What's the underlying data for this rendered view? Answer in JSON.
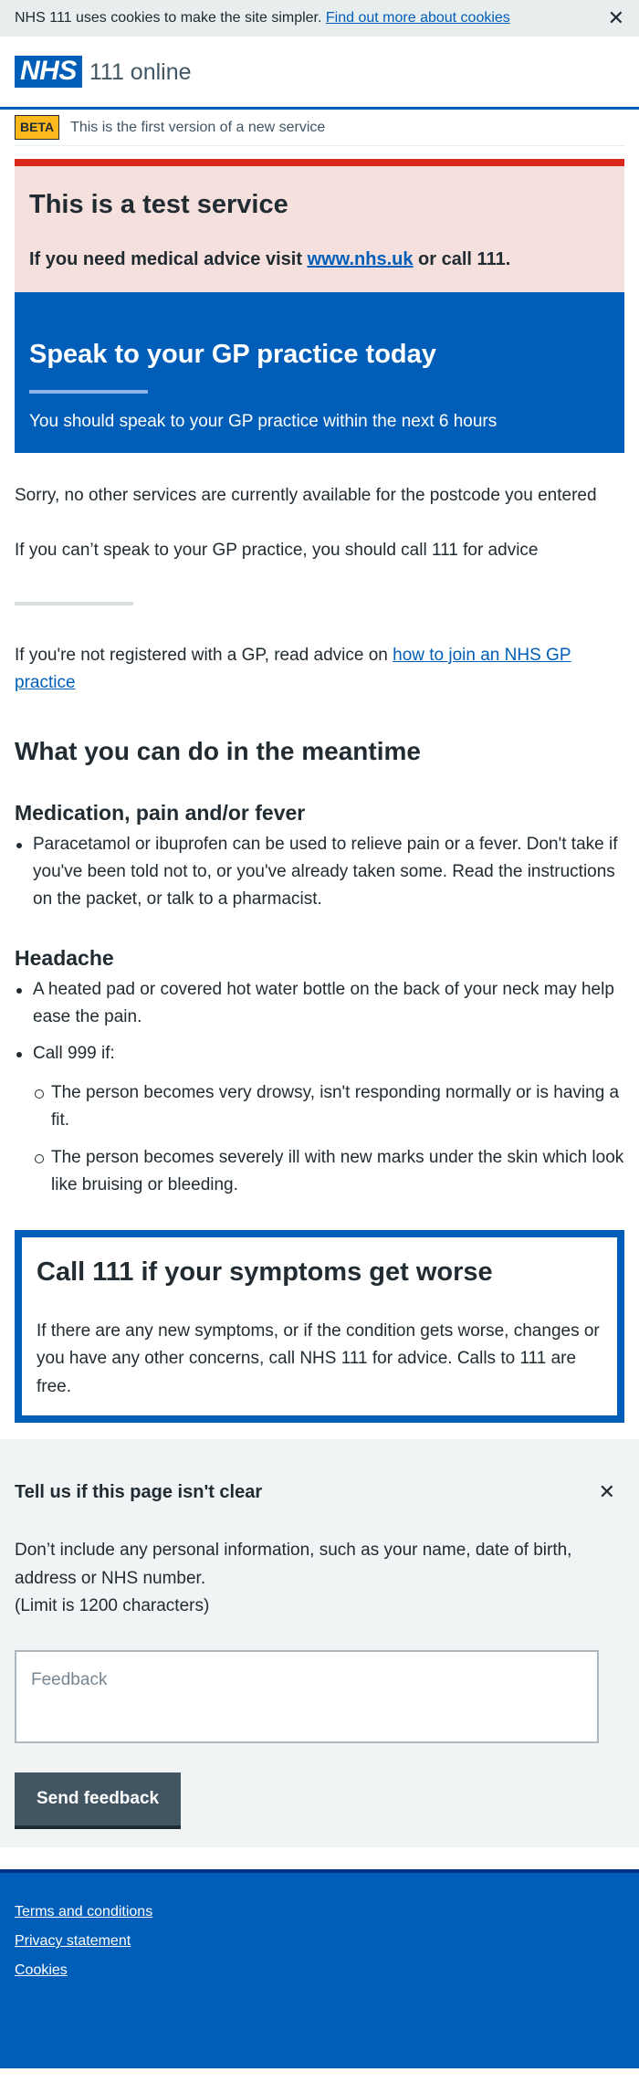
{
  "cookie_banner": {
    "text": "NHS 111 uses cookies to make the site simpler.",
    "link": "Find out more about cookies",
    "close": "✕"
  },
  "header": {
    "logo": "NHS",
    "service_name": "111 online"
  },
  "beta": {
    "tag": "BETA",
    "text": "This is the first version of a new service"
  },
  "test_service": {
    "title": "This is a test service",
    "text_before": "If you need medical advice visit ",
    "link": "www.nhs.uk",
    "text_after": " or call 111."
  },
  "disposition": {
    "title": "Speak to your GP practice today",
    "subtitle": "You should speak to your GP practice within the next 6 hours"
  },
  "body": {
    "sorry": "Sorry, no other services are currently available for the postcode you entered",
    "call_111": "If you can’t speak to your GP practice, you should call 111 for advice",
    "not_registered_before": "If you're not registered with a GP, read advice on ",
    "not_registered_link": "how to join an NHS GP practice"
  },
  "meantime": {
    "heading": "What you can do in the meantime",
    "sections": [
      {
        "title": "Medication, pain and/or fever",
        "items": [
          "Paracetamol or ibuprofen can be used to relieve pain or a fever. Don't take if you've been told not to, or you've already taken some. Read the instructions on the packet, or talk to a pharmacist."
        ]
      },
      {
        "title": "Headache",
        "item_1": "A heated pad or covered hot water bottle on the back of your neck may help ease the pain.",
        "item_2": "Call 999 if:",
        "sub_items": [
          "The person becomes very drowsy, isn't responding normally or is having a fit.",
          "The person becomes severely ill with new marks under the skin which look like bruising or bleeding."
        ]
      }
    ]
  },
  "care_box": {
    "title": "Call 111 if your symptoms get worse",
    "text": "If there are any new symptoms, or if the condition gets worse, changes or you have any other concerns, call NHS 111 for advice. Calls to 111 are free."
  },
  "feedback": {
    "title": "Tell us if this page isn't clear",
    "close": "✕",
    "info": "Don’t include any personal information, such as your name, date of birth, address or NHS number.",
    "limit": "(Limit is 1200 characters)",
    "placeholder": "Feedback",
    "button": "Send feedback"
  },
  "footer": {
    "links": [
      "Terms and conditions",
      "Privacy statement",
      "Cookies"
    ]
  },
  "colors": {
    "nhs_blue": "#005eb8",
    "warning_red": "#da291c",
    "warning_bg": "#f6e0dd",
    "beta_yellow": "#ffb81c"
  }
}
